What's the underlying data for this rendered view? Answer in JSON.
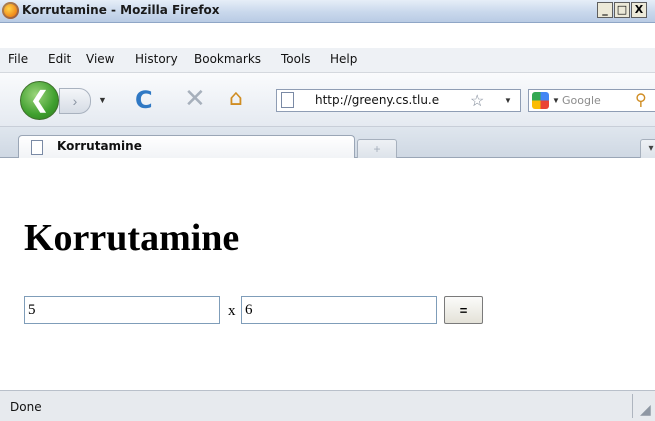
{
  "window": {
    "title": "Korrutamine - Mozilla Firefox",
    "minimize": "_",
    "maximize": "□",
    "close": "X"
  },
  "menu": [
    "File",
    "Edit",
    "View",
    "History",
    "Bookmarks",
    "Tools",
    "Help"
  ],
  "nav": {
    "back": "❮",
    "forward": "›",
    "dropdown": "▼",
    "reload_icon": "C",
    "stop_icon": "✕",
    "home_icon": "⌂",
    "url": "http://greeny.cs.tlu.e",
    "bookmark_star": "☆",
    "url_dropdown": "▼",
    "search_dropdown": "▼",
    "search_placeholder": "Google",
    "magnifier": "⚲"
  },
  "tabs": {
    "active_label": "Korrutamine",
    "new_tab": "+",
    "list": "▾"
  },
  "page": {
    "heading": "Korrutamine",
    "input_a": "5",
    "operator": "x",
    "input_b": "6",
    "submit_label": "="
  },
  "status": {
    "text": "Done",
    "grip": "◢"
  },
  "colors": {
    "titlebar": "#c9d8ec",
    "back_button": "#3f9f2e",
    "reload": "#2f78c4",
    "home": "#d08d23"
  }
}
